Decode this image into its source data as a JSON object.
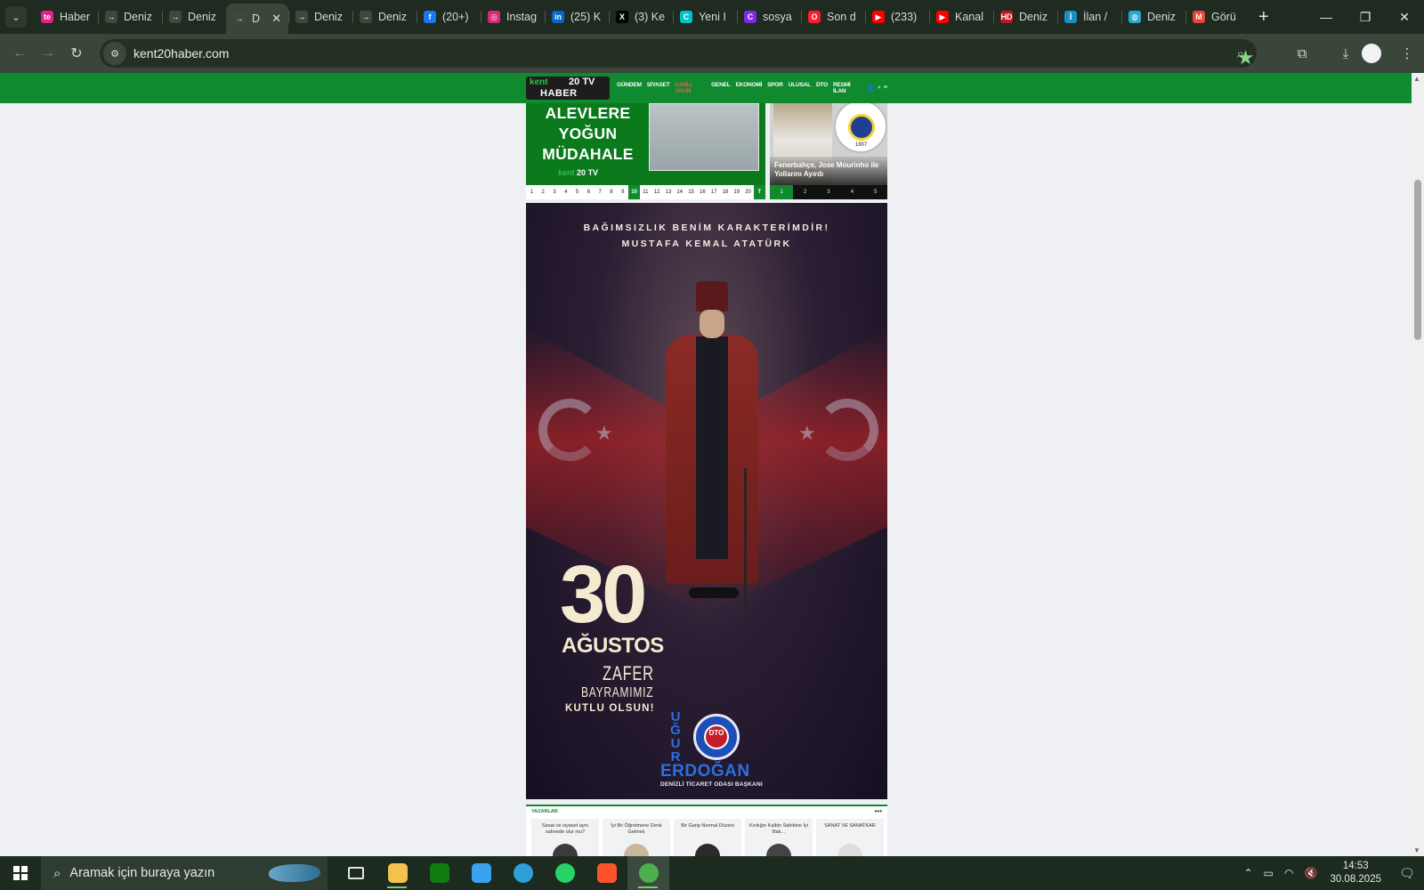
{
  "browser": {
    "tabs": [
      {
        "title": "Haber",
        "icon": "te-icon",
        "color": "#e0218a",
        "glyph": "te"
      },
      {
        "title": "Deniz",
        "icon": "page-icon",
        "color": "#3c4a3c",
        "glyph": "→"
      },
      {
        "title": "Deniz",
        "icon": "page-icon",
        "color": "#3c4a3c",
        "glyph": "→"
      },
      {
        "title": "D",
        "icon": "page-icon",
        "color": "#3c4a3c",
        "glyph": "→",
        "active": true
      },
      {
        "title": "Deniz",
        "icon": "page-icon",
        "color": "#3c4a3c",
        "glyph": "→"
      },
      {
        "title": "Deniz",
        "icon": "page-icon",
        "color": "#3c4a3c",
        "glyph": "→"
      },
      {
        "title": "(20+)",
        "icon": "facebook-icon",
        "color": "#1877f2",
        "glyph": "f"
      },
      {
        "title": "Instag",
        "icon": "instagram-icon",
        "color": "#d62976",
        "glyph": "◎"
      },
      {
        "title": "(25) K",
        "icon": "linkedin-icon",
        "color": "#0a66c2",
        "glyph": "in"
      },
      {
        "title": "(3) Ke",
        "icon": "x-icon",
        "color": "#000000",
        "glyph": "X"
      },
      {
        "title": "Yeni I",
        "icon": "canva-icon",
        "color": "#00c4cc",
        "glyph": "C"
      },
      {
        "title": "sosya",
        "icon": "canva-icon",
        "color": "#7d2ae8",
        "glyph": "C"
      },
      {
        "title": "Son d",
        "icon": "opera-icon",
        "color": "#ff1b2d",
        "glyph": "O"
      },
      {
        "title": "(233)",
        "icon": "youtube-icon",
        "color": "#ff0000",
        "glyph": "▶"
      },
      {
        "title": "Kanal",
        "icon": "youtube-icon",
        "color": "#ff0000",
        "glyph": "▶"
      },
      {
        "title": "Deniz",
        "icon": "hd-icon",
        "color": "#c0161c",
        "glyph": "HD"
      },
      {
        "title": "İlan /",
        "icon": "ilan-icon",
        "color": "#1a8fc7",
        "glyph": "İ"
      },
      {
        "title": "Deniz",
        "icon": "globe-icon",
        "color": "#29a8d6",
        "glyph": "◍"
      },
      {
        "title": "Görü",
        "icon": "gmail-icon",
        "color": "#ea4335",
        "glyph": "M"
      }
    ],
    "url": "kent20haber.com"
  },
  "site": {
    "logo": {
      "kent": "kent",
      "num": "20",
      "tv": "TV",
      "haber": "HABER"
    },
    "menu": [
      "GÜNDEM",
      "SİYASET",
      "CANLI YAYIN",
      "GENEL",
      "EKONOMİ",
      "SPOR",
      "ULUSAL",
      "DTO",
      "RESMİ İLAN"
    ],
    "slider": {
      "headline": "ALEVLERE YOĞUN MÜDAHALE",
      "watermark_kent": "kent",
      "watermark_num": "20",
      "watermark_tv": "TV",
      "pages": [
        "1",
        "2",
        "3",
        "4",
        "5",
        "6",
        "7",
        "8",
        "9",
        "10",
        "11",
        "12",
        "13",
        "14",
        "15",
        "16",
        "17",
        "18",
        "19",
        "20",
        "T"
      ],
      "active_page": "10"
    },
    "side_slider": {
      "caption": "Fenerbahçe, Jose Mourinho ile Yollarını Ayırdı",
      "crest_year": "1907",
      "pages": [
        "1",
        "2",
        "3",
        "4",
        "5"
      ],
      "active_page": "1"
    },
    "banner": {
      "quote_line1": "BAĞIMSIZLIK BENİM KARAKTERİMDİR!",
      "quote_line2": "MUSTAFA KEMAL ATATÜRK",
      "day": "30",
      "month": "AĞUSTOS",
      "zafer": "ZAFER",
      "bayram": "BAYRAMIMIZ",
      "kutlu": "KUTLU OLSUN!",
      "ugur": [
        "U",
        "Ğ",
        "U",
        "R"
      ],
      "seal_text": "DTO",
      "surname": "ERDOĞAN",
      "title": "DENİZLİ TİCARET ODASI BAŞKANI"
    },
    "authors": {
      "title": "YAZARLAR",
      "cards": [
        "Sanat ve siyaset aynı sahnede olur mu?",
        "İyi Bir Öğretmene Denk Gelmek",
        "Bir Garip Normal Düzeni",
        "Kırdığın Kalbin Sahibine İyi Bak...",
        "SANAT VE SANATKAR"
      ]
    }
  },
  "taskbar": {
    "search_placeholder": "Aramak için buraya yazın",
    "time": "14:53",
    "date": "30.08.2025",
    "apps": [
      {
        "name": "task-view",
        "color": "#1c2a1f"
      },
      {
        "name": "file-explorer",
        "color": "#f2c14e"
      },
      {
        "name": "xbox",
        "color": "#107c10"
      },
      {
        "name": "microsoft-store",
        "color": "#3aa0f0"
      },
      {
        "name": "edge",
        "color": "#2f9fd8"
      },
      {
        "name": "whatsapp",
        "color": "#25d366"
      },
      {
        "name": "brave",
        "color": "#fb542b"
      },
      {
        "name": "chrome",
        "color": "#4caf50"
      }
    ]
  }
}
